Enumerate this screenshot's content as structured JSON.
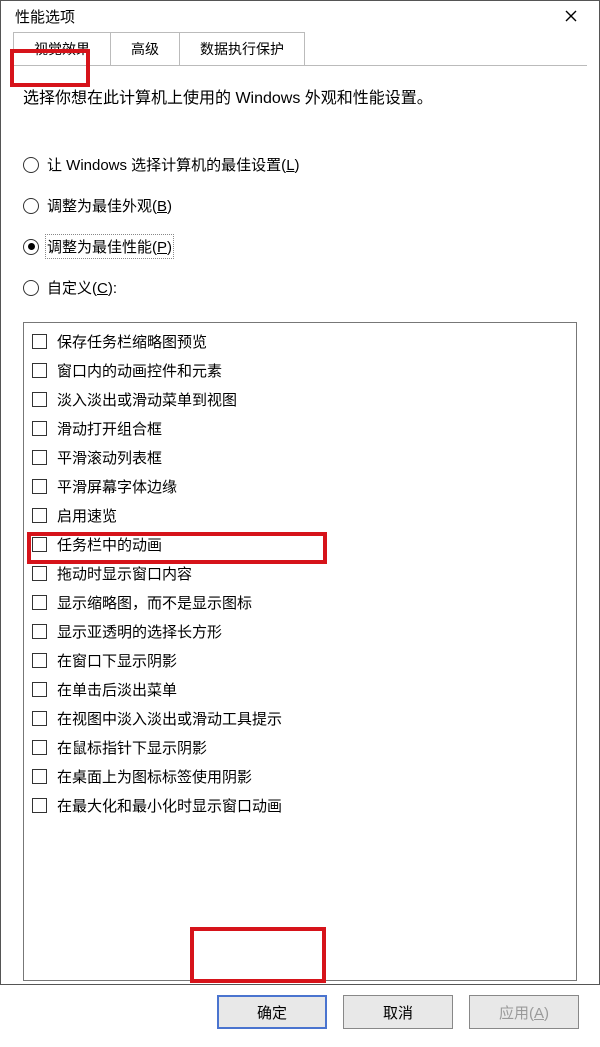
{
  "window": {
    "title": "性能选项"
  },
  "tabs": [
    {
      "label": "视觉效果",
      "active": true
    },
    {
      "label": "高级",
      "active": false
    },
    {
      "label": "数据执行保护",
      "active": false
    }
  ],
  "intro": "选择你想在此计算机上使用的 Windows 外观和性能设置。",
  "radios": [
    {
      "label_pre": "让 Windows 选择计算机的最佳设置(",
      "underline": "L",
      "label_post": ")",
      "selected": false
    },
    {
      "label_pre": "调整为最佳外观(",
      "underline": "B",
      "label_post": ")",
      "selected": false
    },
    {
      "label_pre": "调整为最佳性能(",
      "underline": "P",
      "label_post": ")",
      "selected": true
    },
    {
      "label_pre": "自定义(",
      "underline": "C",
      "label_post": "):",
      "selected": false
    }
  ],
  "options": [
    "保存任务栏缩略图预览",
    "窗口内的动画控件和元素",
    "淡入淡出或滑动菜单到视图",
    "滑动打开组合框",
    "平滑滚动列表框",
    "平滑屏幕字体边缘",
    "启用速览",
    "任务栏中的动画",
    "拖动时显示窗口内容",
    "显示缩略图，而不是显示图标",
    "显示亚透明的选择长方形",
    "在窗口下显示阴影",
    "在单击后淡出菜单",
    "在视图中淡入淡出或滑动工具提示",
    "在鼠标指针下显示阴影",
    "在桌面上为图标标签使用阴影",
    "在最大化和最小化时显示窗口动画"
  ],
  "buttons": {
    "ok": "确定",
    "cancel": "取消",
    "apply_pre": "应用(",
    "apply_u": "A",
    "apply_post": ")"
  }
}
